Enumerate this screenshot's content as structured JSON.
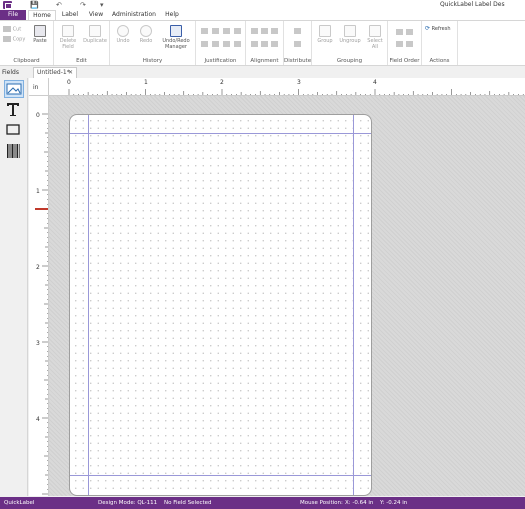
{
  "titlebar": {
    "title": "QuickLabel Label Des",
    "qa_save": "💾",
    "qa_undo": "↶",
    "qa_redo": "↷",
    "qa_customize": "▾"
  },
  "tabs": {
    "file": "File",
    "home": "Home",
    "label": "Label",
    "view": "View",
    "administration": "Administration",
    "help": "Help"
  },
  "ribbon": {
    "clipboard": {
      "cut": "Cut",
      "copy": "Copy",
      "paste": "Paste",
      "label": "Clipboard"
    },
    "edit": {
      "delete_field": "Delete Field",
      "duplicate": "Duplicate",
      "label": "Edit"
    },
    "history": {
      "undo": "Undo",
      "redo": "Redo",
      "undo_redo_manager": "Undo/Redo Manager",
      "label": "History"
    },
    "justification": {
      "label": "Justification"
    },
    "alignment": {
      "label": "Alignment"
    },
    "distribute": {
      "label": "Distribute"
    },
    "grouping": {
      "group": "Group",
      "ungroup": "Ungroup",
      "select_all": "Select All",
      "label": "Grouping"
    },
    "field_order": {
      "label": "Field Order"
    },
    "actions": {
      "refresh": "Refresh",
      "label": "Actions"
    }
  },
  "fields_panel": {
    "header": "Fields"
  },
  "document": {
    "tab_title": "Untitled-1*",
    "close": "✕"
  },
  "ruler": {
    "unit": "in",
    "h_numbers": [
      "0",
      "1",
      "2",
      "3",
      "4"
    ],
    "v_numbers": [
      "0",
      "1",
      "2",
      "3",
      "4"
    ]
  },
  "statusbar": {
    "app": "QuickLabel",
    "design_mode": "Design Mode: QL-111",
    "selection": "No Field Selected",
    "mouse_position": "Mouse Position:",
    "x": "X: -0.64 in",
    "y": "Y: -0.24 in"
  },
  "colors": {
    "accent": "#6b2f86",
    "ruler_marker": "#c0392b",
    "margin_line": "#9a98d8"
  }
}
